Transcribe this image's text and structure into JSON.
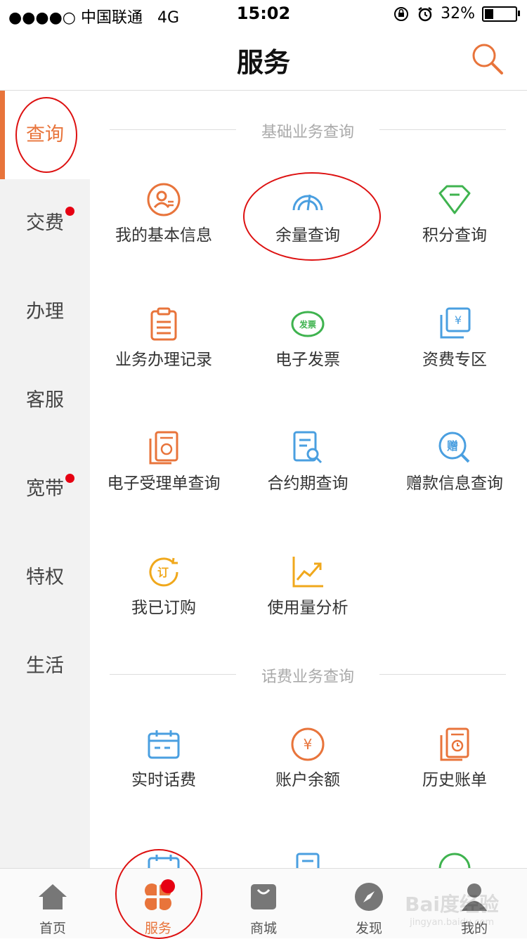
{
  "status": {
    "carrier": "●●●●○ 中国联通",
    "network": "4G",
    "time": "15:02",
    "battery": "32%"
  },
  "header": {
    "title": "服务"
  },
  "sidebar": {
    "items": [
      {
        "label": "查询"
      },
      {
        "label": "交费"
      },
      {
        "label": "办理"
      },
      {
        "label": "客服"
      },
      {
        "label": "宽带"
      },
      {
        "label": "特权"
      },
      {
        "label": "生活"
      }
    ]
  },
  "sections": [
    {
      "title": "基础业务查询",
      "tiles": [
        {
          "label": "我的基本信息",
          "icon": "user-info-icon"
        },
        {
          "label": "余量查询",
          "icon": "gauge-icon"
        },
        {
          "label": "积分查询",
          "icon": "diamond-icon"
        },
        {
          "label": "业务办理记录",
          "icon": "clipboard-icon"
        },
        {
          "label": "电子发票",
          "icon": "invoice-icon"
        },
        {
          "label": "资费专区",
          "icon": "yen-card-icon"
        },
        {
          "label": "电子受理单查询",
          "icon": "receipt-icon"
        },
        {
          "label": "合约期查询",
          "icon": "document-search-icon"
        },
        {
          "label": "赠款信息查询",
          "icon": "gift-search-icon"
        },
        {
          "label": "我已订购",
          "icon": "subscribe-icon"
        },
        {
          "label": "使用量分析",
          "icon": "trend-chart-icon"
        }
      ]
    },
    {
      "title": "话费业务查询",
      "tiles": [
        {
          "label": "实时话费",
          "icon": "calendar-icon"
        },
        {
          "label": "账户余额",
          "icon": "yen-circle-icon"
        },
        {
          "label": "历史账单",
          "icon": "history-bill-icon"
        }
      ]
    }
  ],
  "tabbar": {
    "tabs": [
      {
        "label": "首页",
        "icon": "home-icon"
      },
      {
        "label": "服务",
        "icon": "service-clover-icon"
      },
      {
        "label": "商城",
        "icon": "shopping-bag-icon"
      },
      {
        "label": "发现",
        "icon": "compass-icon"
      },
      {
        "label": "我的",
        "icon": "person-icon"
      }
    ]
  },
  "watermark": {
    "text": "Bai度经验",
    "sub": "jingyan.baidu.com"
  },
  "colors": {
    "accent": "#e8743b",
    "badge": "#e60012",
    "blue": "#4a9fe0",
    "green": "#3fb34f",
    "yellow": "#f0a81c"
  }
}
